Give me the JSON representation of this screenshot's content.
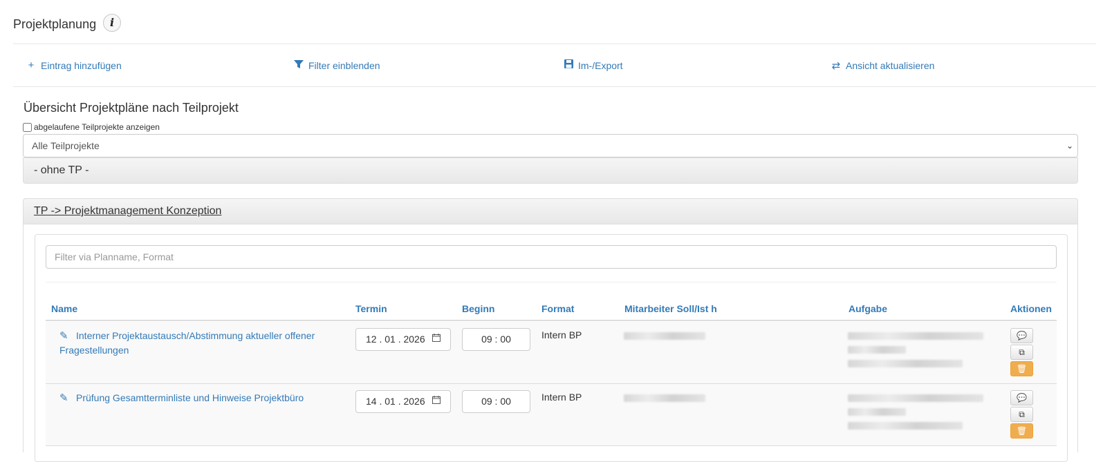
{
  "header": {
    "title": "Projektplanung",
    "info_label": "i"
  },
  "toolbar": {
    "add": "Eintrag hinzufügen",
    "filter": "Filter einblenden",
    "import_export": "Im-/Export",
    "refresh": "Ansicht aktualisieren"
  },
  "overview": {
    "title": "Übersicht Projektpläne nach Teilprojekt",
    "show_expired_label": "abgelaufene Teilprojekte anzeigen",
    "select_value": "Alle Teilprojekte"
  },
  "panels": [
    {
      "title": "- ohne TP -"
    },
    {
      "title": "TP -> Projektmanagement Konzeption"
    }
  ],
  "table": {
    "filter_placeholder": "Filter via Planname, Format",
    "columns": [
      "Name",
      "Termin",
      "Beginn",
      "Format",
      "Mitarbeiter Soll/Ist h",
      "Aufgabe",
      "Aktionen"
    ],
    "rows": [
      {
        "name": "Interner Projektaustausch/Abstimmung aktueller offener Fragestellungen",
        "date": "12 . 01 . 2026",
        "time": "09 : 00",
        "format": "Intern BP"
      },
      {
        "name": "Prüfung Gesamtterminliste und Hinweise Projektbüro",
        "date": "14 . 01 . 2026",
        "time": "09 : 00",
        "format": "Intern BP"
      }
    ]
  },
  "icons": {
    "plus": "plus-icon",
    "filter": "funnel-icon",
    "save": "floppy-icon",
    "refresh": "refresh-icon",
    "edit": "pencil-icon",
    "calendar": "calendar-icon",
    "comment": "comment-icon",
    "copy": "copy-icon",
    "delete": "trash-icon"
  },
  "colors": {
    "link": "#337ab7",
    "delete_button": "#f0ad4e"
  }
}
